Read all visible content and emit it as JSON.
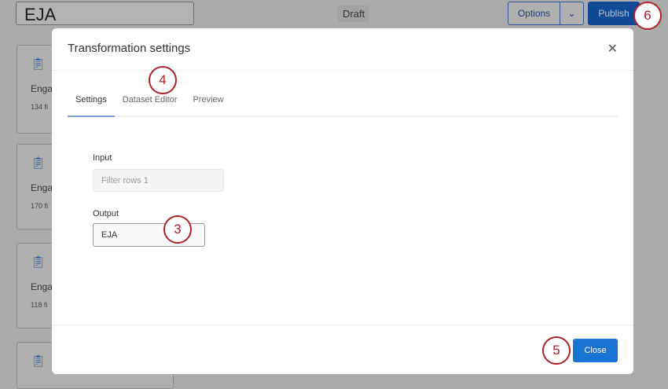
{
  "header": {
    "title": "EJA",
    "status": "Draft",
    "options_label": "Options",
    "publish_label": "Publish"
  },
  "cards": [
    {
      "name": "Enga",
      "count": "134 fi"
    },
    {
      "name": "Enga",
      "count": "170 fi"
    },
    {
      "name": "Enga",
      "count": "118 fi"
    },
    {
      "name": "",
      "count": ""
    }
  ],
  "modal": {
    "title": "Transformation settings",
    "tabs": [
      "Settings",
      "Dataset Editor",
      "Preview"
    ],
    "input_label": "Input",
    "input_placeholder": "Filter rows 1",
    "output_label": "Output",
    "output_value": "EJA",
    "close_label": "Close"
  },
  "markers": [
    "3",
    "4",
    "5",
    "6"
  ]
}
